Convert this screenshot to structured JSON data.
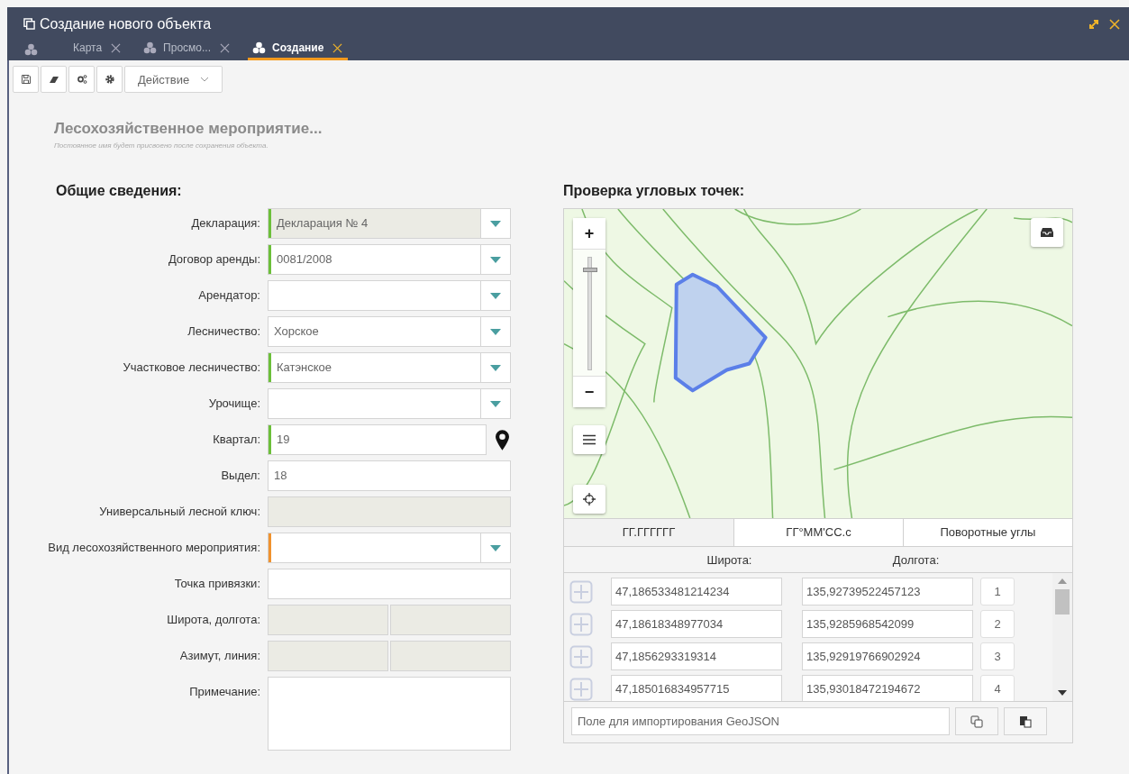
{
  "window": {
    "title": "Создание нового объекта"
  },
  "tabs": [
    {
      "label": "Карта",
      "selected": false
    },
    {
      "label": "Просмо...",
      "selected": false
    },
    {
      "label": "Создание",
      "selected": true
    }
  ],
  "toolbar": {
    "action_menu": "Действие"
  },
  "object": {
    "title": "Лесохозяйственное мероприятие...",
    "note": "Постоянное имя будет присвоено после сохранения объекта."
  },
  "general": {
    "heading": "Общие сведения:",
    "fields": [
      {
        "label": "Декларация:",
        "kind": "select",
        "value": "Декларация № 4",
        "color": "#6cbf3a",
        "disabled": true
      },
      {
        "label": "Договор аренды:",
        "kind": "select",
        "value": "0081/2008",
        "color": "#6cbf3a",
        "disabled": false
      },
      {
        "label": "Арендатор:",
        "kind": "select",
        "disabled": false
      },
      {
        "label": "Лесничество:",
        "kind": "select",
        "value": "Хорское",
        "disabled": false
      },
      {
        "label": "Участковое лесничество:",
        "kind": "select",
        "value": "Катэнское",
        "color": "#6cbf3a",
        "disabled": false
      },
      {
        "label": "Урочище:",
        "kind": "select",
        "disabled": false
      },
      {
        "label": "Квартал:",
        "kind": "pin",
        "value": "19",
        "color": "#6cbf3a",
        "disabled": false
      },
      {
        "label": "Выдел:",
        "kind": "input",
        "value": "18",
        "disabled": false
      },
      {
        "label": "Универсальный лесной ключ:",
        "kind": "input",
        "disabled": true
      },
      {
        "label": "Вид лесохозяйственного мероприятия:",
        "kind": "select",
        "color": "#f0922e",
        "disabled": false
      },
      {
        "label": "Точка привязки:",
        "kind": "input",
        "disabled": false
      },
      {
        "label": "Широта, долгота:",
        "kind": "pair",
        "disabled": true
      },
      {
        "label": "Азимут, линия:",
        "kind": "pair",
        "disabled": true
      },
      {
        "label": "Примечание:",
        "kind": "textarea",
        "disabled": false
      }
    ]
  },
  "corners": {
    "heading": "Проверка угловых точек:",
    "map": {
      "kind": "picture",
      "zoom_in": "+",
      "zoom_out": "−",
      "zoom": {
        "level": 0.92
      }
    },
    "formats": [
      {
        "label": "ГГ.ГГГГГГ",
        "selected": true
      },
      {
        "label": "ГГ°ММ'СС.с",
        "selected": false
      },
      {
        "label": "Поворотные углы",
        "selected": false
      }
    ],
    "columns": [
      "Широта:",
      "Долгота:"
    ],
    "points": [
      {
        "lat": "47,186533481214234",
        "lon": "135,92739522457123",
        "n": "1"
      },
      {
        "lat": "47,18618348977034",
        "lon": "135,9285968542099",
        "n": "2"
      },
      {
        "lat": "47,1856293319314",
        "lon": "135,92919766902924",
        "n": "3"
      },
      {
        "lat": "47,185016834957715",
        "lon": "135,93018472194672",
        "n": "4"
      }
    ],
    "import": {
      "placeholder": "Поле для импортирования GeoJSON"
    }
  }
}
